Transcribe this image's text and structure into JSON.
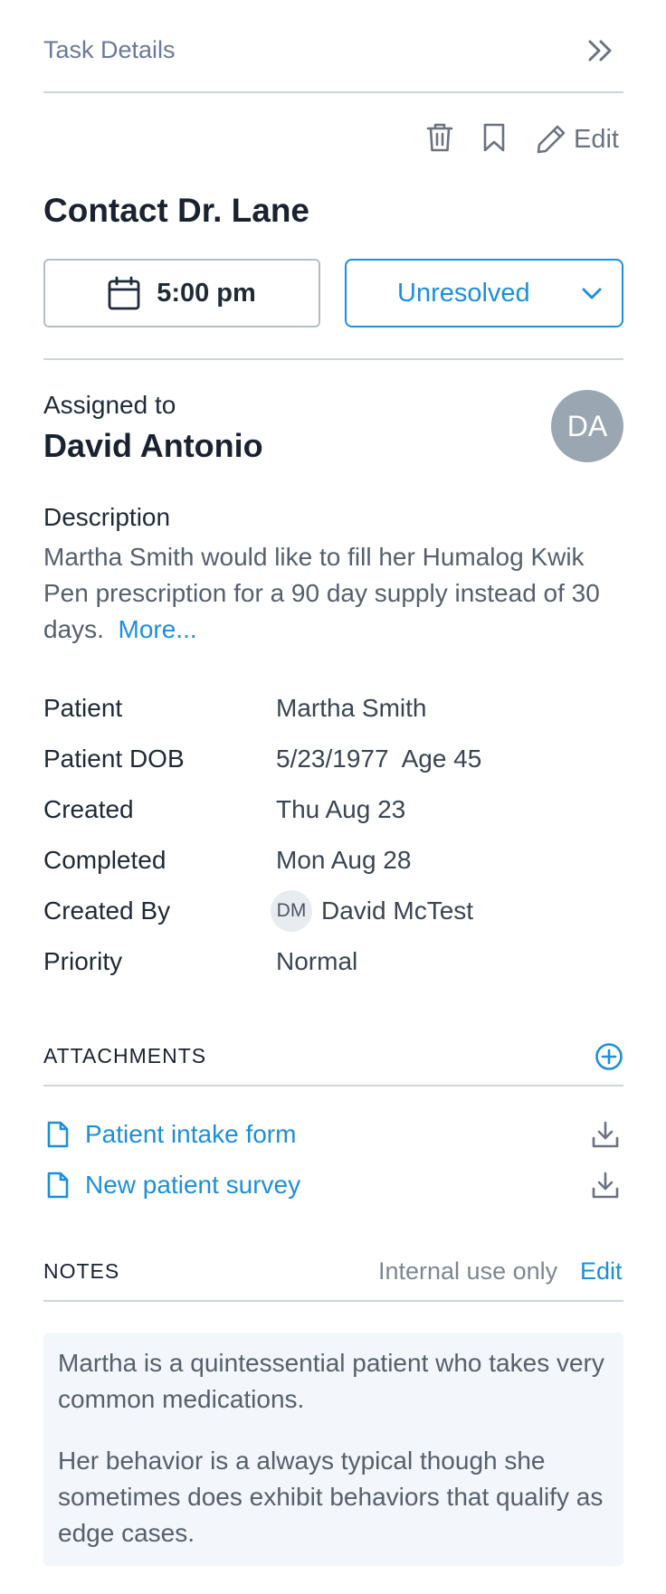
{
  "header": {
    "title": "Task Details",
    "collapse_icon": "double-chevron-right-icon"
  },
  "toolbar": {
    "delete_icon": "trash-icon",
    "bookmark_icon": "bookmark-icon",
    "edit_icon": "pencil-icon",
    "edit_label": "Edit"
  },
  "task": {
    "title": "Contact Dr. Lane",
    "time": "5:00 pm",
    "status": "Unresolved"
  },
  "assignee": {
    "label": "Assigned to",
    "name": "David Antonio",
    "initials": "DA"
  },
  "description": {
    "label": "Description",
    "text": "Martha Smith would like to fill her Humalog Kwik Pen prescription for a 90 day supply instead of 30 days.",
    "more_label": "More..."
  },
  "details": [
    {
      "label": "Patient",
      "value": "Martha Smith"
    },
    {
      "label": "Patient DOB",
      "value": "5/23/1977  Age 45"
    },
    {
      "label": "Created",
      "value": "Thu Aug 23"
    },
    {
      "label": "Completed",
      "value": "Mon Aug 28"
    },
    {
      "label": "Created By",
      "value": "David McTest",
      "initials": "DM"
    },
    {
      "label": "Priority",
      "value": "Normal"
    }
  ],
  "attachments": {
    "heading": "ATTACHMENTS",
    "add_icon": "plus-circle-icon",
    "items": [
      {
        "name": "Patient intake form",
        "icon": "document-icon",
        "action_icon": "download-icon"
      },
      {
        "name": "New patient survey",
        "icon": "document-icon",
        "action_icon": "download-icon"
      }
    ]
  },
  "notes": {
    "heading": "NOTES",
    "subtitle": "Internal use only",
    "edit_label": "Edit",
    "paragraphs": [
      "Martha is a quintessential patient who takes very common medications.",
      "Her behavior is a always typical though she sometimes does exhibit behaviors that qualify as edge cases."
    ]
  },
  "colors": {
    "accent": "#1d8fd9",
    "avatar_bg": "#9aa7b2",
    "notes_bg": "#f3f6fa"
  }
}
